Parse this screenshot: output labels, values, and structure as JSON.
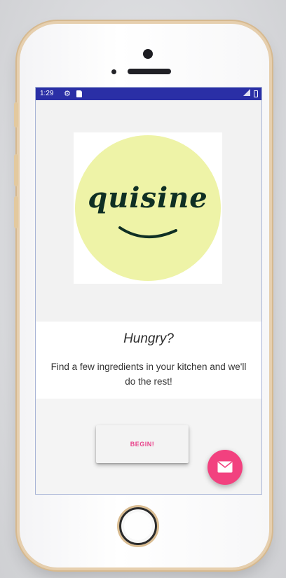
{
  "status_bar": {
    "time": "1:29"
  },
  "logo": {
    "text": "quisine"
  },
  "message": {
    "headline": "Hungry?",
    "subtext": "Find a few ingredients in your kitchen and we'll do the rest!"
  },
  "actions": {
    "begin_label": "BEGIN!"
  },
  "icons": {
    "settings": "gear-icon",
    "sd_card": "sd-card-icon",
    "signal": "signal-icon",
    "battery": "battery-icon",
    "fab": "email-icon"
  },
  "colors": {
    "status_bar": "#2a2fa6",
    "logo_circle": "#eef3a7",
    "logo_text": "#0f2f24",
    "accent_pink": "#f2417f",
    "begin_text": "#e8428a"
  }
}
